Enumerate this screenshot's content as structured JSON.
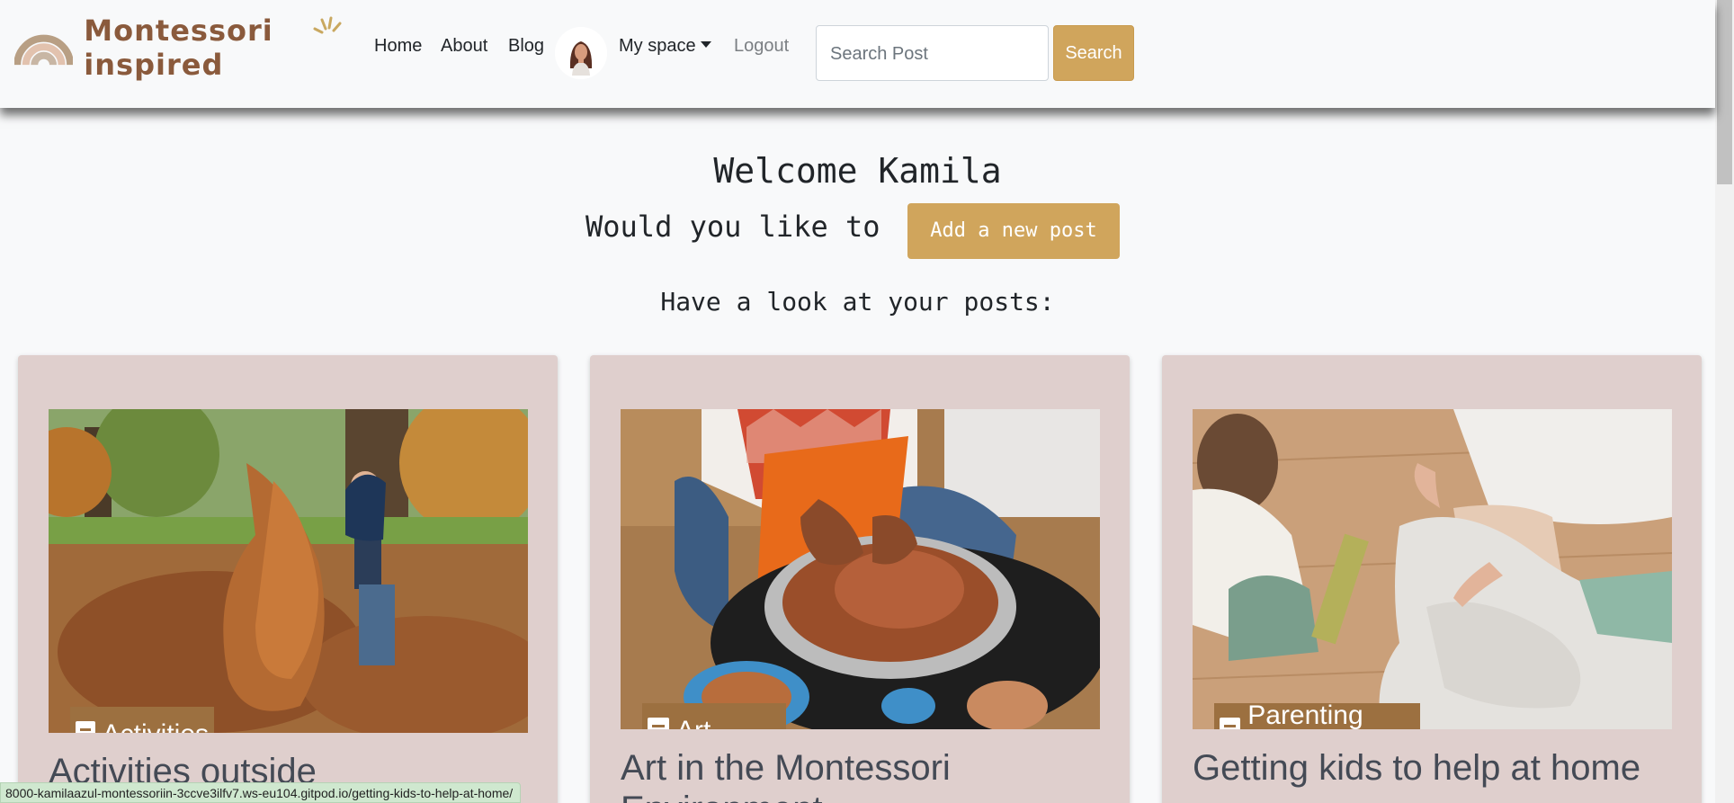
{
  "brand": {
    "name": "Montessori inspired"
  },
  "nav": {
    "home": "Home",
    "about": "About",
    "blog": "Blog",
    "my_space": "My space",
    "logout": "Logout"
  },
  "search": {
    "placeholder": "Search Post",
    "button": "Search"
  },
  "main": {
    "welcome": "Welcome Kamila",
    "would_like": "Would you like to",
    "add_post": "Add a new post",
    "have_look": "Have a look at your posts:"
  },
  "posts": [
    {
      "category": "Activities",
      "title": "Activities outside"
    },
    {
      "category": "Art",
      "title": "Art in the Montessori Environment"
    },
    {
      "category": "Parenting Tips",
      "title": "Getting kids to help at home"
    }
  ],
  "status_url": "8000-kamilaazul-montessoriin-3ccve3ilfv7.ws-eu104.gitpod.io/getting-kids-to-help-at-home/",
  "colors": {
    "accent": "#d0a55c",
    "card_bg": "#dfcfcd",
    "badge": "#9c7040",
    "brand_text": "#8a5a3c"
  }
}
